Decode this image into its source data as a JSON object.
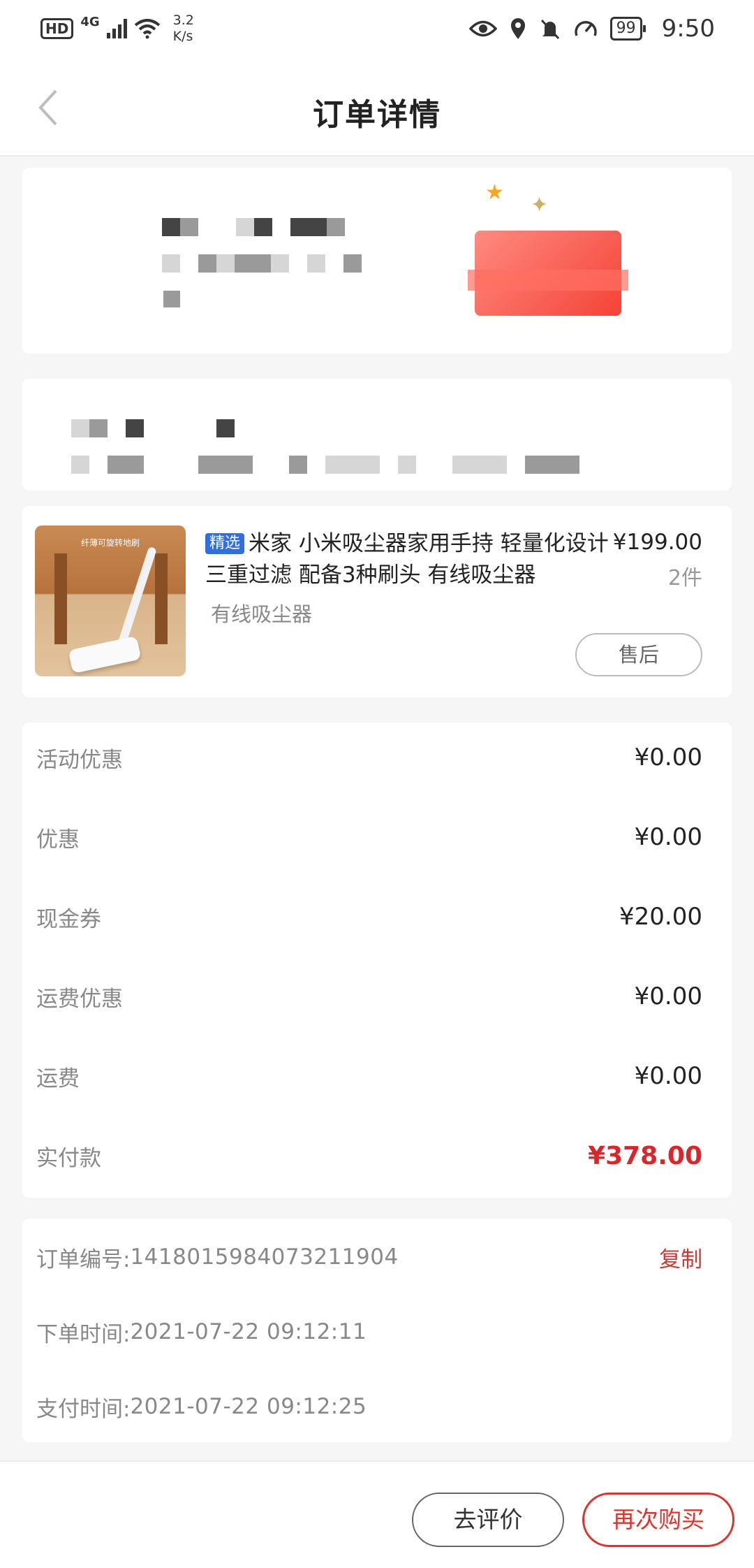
{
  "status_bar": {
    "hd": "HD",
    "network": "4G",
    "speed_value": "3.2",
    "speed_unit": "K/s",
    "battery": "99",
    "time": "9:50"
  },
  "nav": {
    "title": "订单详情"
  },
  "product": {
    "tag": "精选",
    "title": "米家 小米吸尘器家用手持 轻量化设计 三重过滤 配备3种刷头 有线吸尘器",
    "spec": "有线吸尘器",
    "price": "¥199.00",
    "quantity": "2件",
    "after_sale_label": "售后",
    "image_caption": "纤薄可旋转地刷"
  },
  "price_breakdown": [
    {
      "label": "活动优惠",
      "value": "¥0.00"
    },
    {
      "label": "优惠",
      "value": "¥0.00"
    },
    {
      "label": "现金券",
      "value": "¥20.00"
    },
    {
      "label": "运费优惠",
      "value": "¥0.00"
    },
    {
      "label": "运费",
      "value": "¥0.00"
    },
    {
      "label": "实付款",
      "value": "¥378.00"
    }
  ],
  "order_info": {
    "order_no_label": "订单编号:",
    "order_no": "1418015984073211904",
    "copy_label": "复制",
    "order_time_label": "下单时间:",
    "order_time": "2021-07-22 09:12:11",
    "pay_time_label": "支付时间:",
    "pay_time": "2021-07-22 09:12:25"
  },
  "actions": {
    "review_label": "去评价",
    "rebuy_label": "再次购买"
  },
  "colors": {
    "accent_red": "#d9342e",
    "tag_blue": "#2f6fe0"
  }
}
